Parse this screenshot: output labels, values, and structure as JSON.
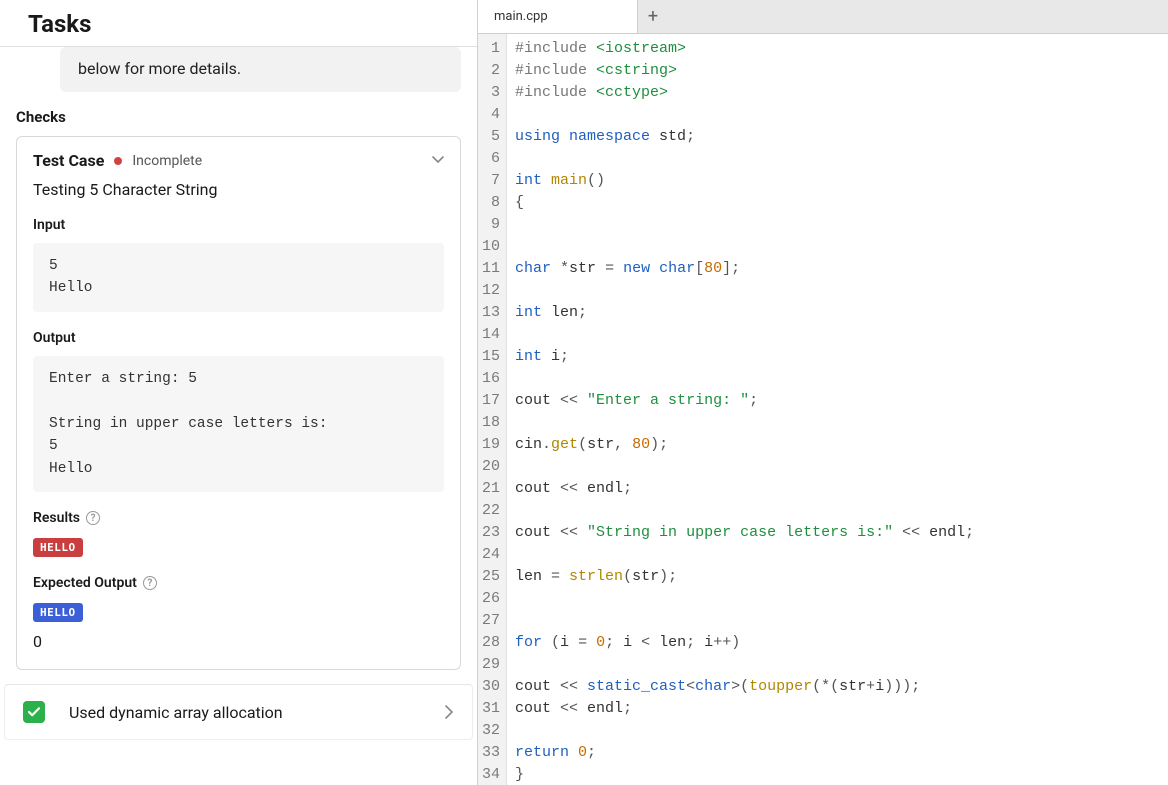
{
  "header": {
    "title": "Tasks"
  },
  "info_box": {
    "text": "below for more details."
  },
  "checks": {
    "heading": "Checks",
    "test_case_label": "Test Case",
    "status_text": "Incomplete",
    "status_color": "#d14343",
    "subtitle": "Testing 5 Character String",
    "input_label": "Input",
    "input_text": "5\nHello",
    "output_label": "Output",
    "output_text": "Enter a string: 5\n\nString in upper case letters is:\n5\nHello",
    "results_label": "Results",
    "results_badge": "HELLO",
    "expected_label": "Expected Output",
    "expected_badge": "HELLO",
    "extra_line": "0"
  },
  "footer": {
    "check_text": "Used dynamic array allocation"
  },
  "editor": {
    "tab_name": "main.cpp",
    "lines": [
      {
        "n": 1,
        "tokens": [
          [
            "pre",
            "#include "
          ],
          [
            "str",
            "<iostream>"
          ]
        ]
      },
      {
        "n": 2,
        "tokens": [
          [
            "pre",
            "#include "
          ],
          [
            "str",
            "<cstring>"
          ]
        ]
      },
      {
        "n": 3,
        "tokens": [
          [
            "pre",
            "#include "
          ],
          [
            "str",
            "<cctype>"
          ]
        ]
      },
      {
        "n": 4,
        "tokens": []
      },
      {
        "n": 5,
        "tokens": [
          [
            "kw",
            "using "
          ],
          [
            "ns",
            "namespace "
          ],
          [
            "ident",
            "std"
          ],
          [
            "op",
            ";"
          ]
        ]
      },
      {
        "n": 6,
        "tokens": []
      },
      {
        "n": 7,
        "tokens": [
          [
            "kw",
            "int "
          ],
          [
            "fn",
            "main"
          ],
          [
            "op",
            "()"
          ]
        ]
      },
      {
        "n": 8,
        "tokens": [
          [
            "op",
            "{"
          ]
        ]
      },
      {
        "n": 9,
        "tokens": []
      },
      {
        "n": 10,
        "tokens": []
      },
      {
        "n": 11,
        "tokens": [
          [
            "kw",
            "char "
          ],
          [
            "op",
            "*"
          ],
          [
            "ident",
            "str "
          ],
          [
            "op",
            "= "
          ],
          [
            "kw",
            "new "
          ],
          [
            "kw",
            "char"
          ],
          [
            "op",
            "["
          ],
          [
            "num",
            "80"
          ],
          [
            "op",
            "];"
          ]
        ]
      },
      {
        "n": 12,
        "tokens": []
      },
      {
        "n": 13,
        "tokens": [
          [
            "kw",
            "int "
          ],
          [
            "ident",
            "len"
          ],
          [
            "op",
            ";"
          ]
        ]
      },
      {
        "n": 14,
        "tokens": []
      },
      {
        "n": 15,
        "tokens": [
          [
            "kw",
            "int "
          ],
          [
            "ident",
            "i"
          ],
          [
            "op",
            ";"
          ]
        ]
      },
      {
        "n": 16,
        "tokens": []
      },
      {
        "n": 17,
        "tokens": [
          [
            "ident",
            "cout "
          ],
          [
            "op",
            "<< "
          ],
          [
            "str",
            "\"Enter a string: \""
          ],
          [
            "op",
            ";"
          ]
        ]
      },
      {
        "n": 18,
        "tokens": []
      },
      {
        "n": 19,
        "tokens": [
          [
            "ident",
            "cin"
          ],
          [
            "op",
            "."
          ],
          [
            "fn",
            "get"
          ],
          [
            "op",
            "("
          ],
          [
            "ident",
            "str"
          ],
          [
            "op",
            ", "
          ],
          [
            "num",
            "80"
          ],
          [
            "op",
            ");"
          ]
        ]
      },
      {
        "n": 20,
        "tokens": []
      },
      {
        "n": 21,
        "tokens": [
          [
            "ident",
            "cout "
          ],
          [
            "op",
            "<< "
          ],
          [
            "ident",
            "endl"
          ],
          [
            "op",
            ";"
          ]
        ]
      },
      {
        "n": 22,
        "tokens": []
      },
      {
        "n": 23,
        "tokens": [
          [
            "ident",
            "cout "
          ],
          [
            "op",
            "<< "
          ],
          [
            "str",
            "\"String in upper case letters is:\""
          ],
          [
            "op",
            " << "
          ],
          [
            "ident",
            "endl"
          ],
          [
            "op",
            ";"
          ]
        ]
      },
      {
        "n": 24,
        "tokens": []
      },
      {
        "n": 25,
        "tokens": [
          [
            "ident",
            "len "
          ],
          [
            "op",
            "= "
          ],
          [
            "fn",
            "strlen"
          ],
          [
            "op",
            "("
          ],
          [
            "ident",
            "str"
          ],
          [
            "op",
            ");"
          ]
        ]
      },
      {
        "n": 26,
        "tokens": []
      },
      {
        "n": 27,
        "tokens": []
      },
      {
        "n": 28,
        "tokens": [
          [
            "kw",
            "for "
          ],
          [
            "op",
            "("
          ],
          [
            "ident",
            "i "
          ],
          [
            "op",
            "= "
          ],
          [
            "num",
            "0"
          ],
          [
            "op",
            "; "
          ],
          [
            "ident",
            "i "
          ],
          [
            "op",
            "< "
          ],
          [
            "ident",
            "len"
          ],
          [
            "op",
            "; "
          ],
          [
            "ident",
            "i"
          ],
          [
            "op",
            "++)"
          ]
        ]
      },
      {
        "n": 29,
        "tokens": []
      },
      {
        "n": 30,
        "tokens": [
          [
            "ident",
            "cout "
          ],
          [
            "op",
            "<< "
          ],
          [
            "kw",
            "static_cast"
          ],
          [
            "op",
            "<"
          ],
          [
            "kw",
            "char"
          ],
          [
            "op",
            ">("
          ],
          [
            "fn",
            "toupper"
          ],
          [
            "op",
            "(*("
          ],
          [
            "ident",
            "str"
          ],
          [
            "op",
            "+"
          ],
          [
            "ident",
            "i"
          ],
          [
            "op",
            ")));"
          ]
        ]
      },
      {
        "n": 31,
        "tokens": [
          [
            "ident",
            "cout "
          ],
          [
            "op",
            "<< "
          ],
          [
            "ident",
            "endl"
          ],
          [
            "op",
            ";"
          ]
        ]
      },
      {
        "n": 32,
        "tokens": []
      },
      {
        "n": 33,
        "tokens": [
          [
            "kw",
            "return "
          ],
          [
            "num",
            "0"
          ],
          [
            "op",
            ";"
          ]
        ]
      },
      {
        "n": 34,
        "tokens": [
          [
            "op",
            "}"
          ]
        ]
      }
    ]
  }
}
